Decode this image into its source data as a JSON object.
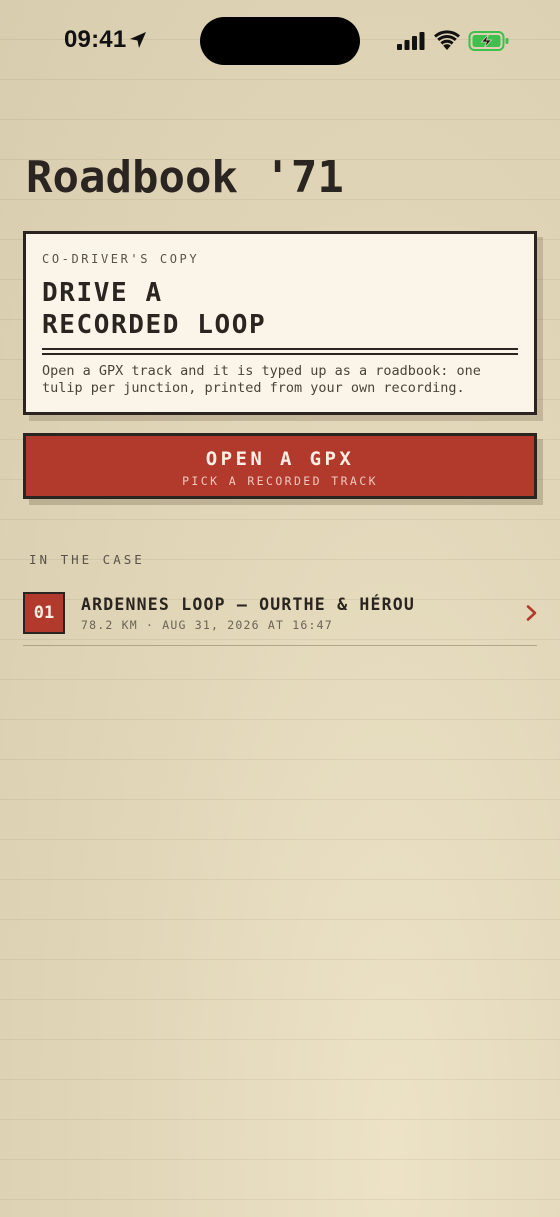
{
  "status_bar": {
    "time": "09:41"
  },
  "app": {
    "title": "Roadbook '71"
  },
  "intro_card": {
    "eyebrow": "CO-DRIVER'S COPY",
    "heading_line1": "DRIVE A",
    "heading_line2": "RECORDED LOOP",
    "body": "Open a GPX track and it is typed up as a roadbook: one tulip per junction, printed from your own recording."
  },
  "open_gpx_button": {
    "label": "OPEN A GPX",
    "sublabel": "PICK A RECORDED TRACK"
  },
  "case_section": {
    "label": "IN THE CASE",
    "items": [
      {
        "index": "01",
        "title": "ARDENNES LOOP — OURTHE & HÉROU",
        "meta": "78.2 KM · AUG 31, 2026 AT 16:47"
      }
    ]
  },
  "colors": {
    "paper": "#ddd2b5",
    "card": "#faf5e8",
    "ink": "#2a2520",
    "accent_red": "#b23a2c",
    "battery_green": "#3fbf4e"
  },
  "icons": {
    "location": "location-arrow-icon",
    "signal": "cellular-signal-icon",
    "wifi": "wifi-icon",
    "battery": "battery-charging-icon",
    "chevron": "chevron-right-icon"
  }
}
